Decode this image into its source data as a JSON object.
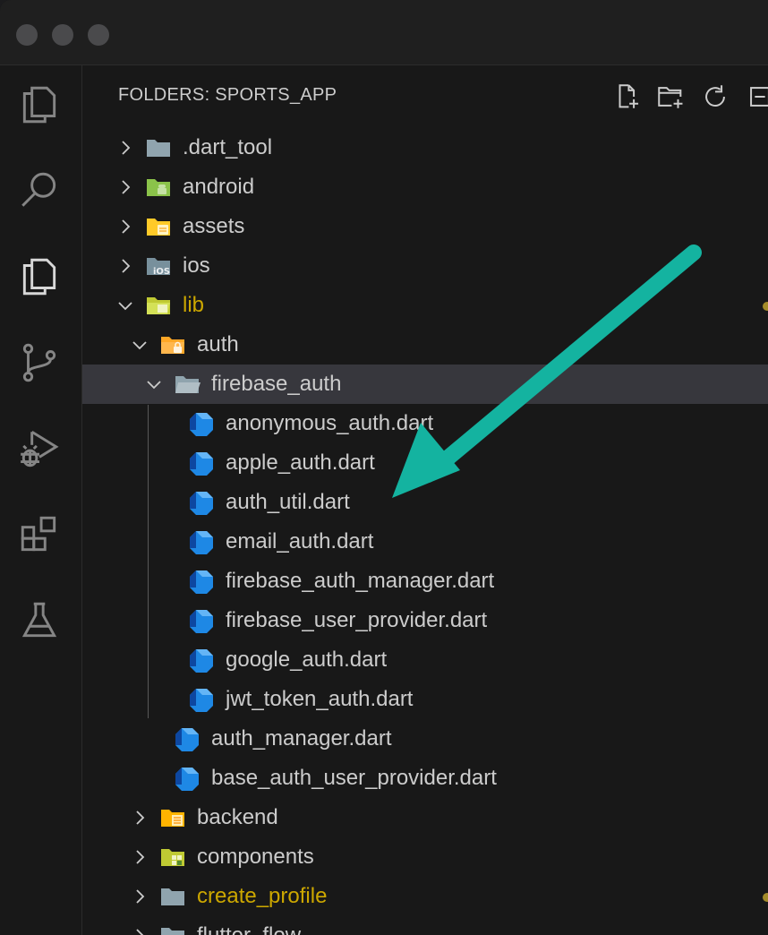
{
  "explorer": {
    "header": "FOLDERS: SPORTS_APP",
    "header_actions": [
      "new-file-icon",
      "new-folder-icon",
      "refresh-icon",
      "collapse-all-icon"
    ],
    "items": [
      {
        "label": ".dart_tool",
        "icon": "folder-icon",
        "expanded": false
      },
      {
        "label": "android",
        "icon": "android-folder-icon",
        "expanded": false
      },
      {
        "label": "assets",
        "icon": "assets-folder-icon",
        "expanded": false
      },
      {
        "label": "ios",
        "icon": "ios-folder-icon",
        "expanded": false
      },
      {
        "label": "lib",
        "icon": "lib-folder-icon",
        "expanded": true,
        "modified": true
      },
      {
        "label": "auth",
        "icon": "auth-folder-icon",
        "expanded": true
      },
      {
        "label": "firebase_auth",
        "icon": "folder-open-icon",
        "expanded": true,
        "selected": true
      },
      {
        "label": "anonymous_auth.dart",
        "icon": "dart-file-icon"
      },
      {
        "label": "apple_auth.dart",
        "icon": "dart-file-icon"
      },
      {
        "label": "auth_util.dart",
        "icon": "dart-file-icon"
      },
      {
        "label": "email_auth.dart",
        "icon": "dart-file-icon"
      },
      {
        "label": "firebase_auth_manager.dart",
        "icon": "dart-file-icon"
      },
      {
        "label": "firebase_user_provider.dart",
        "icon": "dart-file-icon"
      },
      {
        "label": "google_auth.dart",
        "icon": "dart-file-icon"
      },
      {
        "label": "jwt_token_auth.dart",
        "icon": "dart-file-icon"
      },
      {
        "label": "auth_manager.dart",
        "icon": "dart-file-icon"
      },
      {
        "label": "base_auth_user_provider.dart",
        "icon": "dart-file-icon"
      },
      {
        "label": "backend",
        "icon": "backend-folder-icon",
        "expanded": false
      },
      {
        "label": "components",
        "icon": "components-folder-icon",
        "expanded": false
      },
      {
        "label": "create_profile",
        "icon": "folder-icon",
        "expanded": false,
        "modified": true
      },
      {
        "label": "flutter_flow",
        "icon": "folder-icon",
        "expanded": false
      }
    ]
  },
  "activity_bar": [
    "explorer-icon",
    "search-icon",
    "explorer-icon",
    "source-control-icon",
    "run-debug-icon",
    "extensions-icon",
    "testing-icon"
  ],
  "colors": {
    "background": "#181818",
    "text": "#cccccc",
    "modified": "#cca700",
    "selected_row": "#37373d",
    "dart_blue": "#42a5f5",
    "annotation_arrow": "#14b3a0"
  }
}
